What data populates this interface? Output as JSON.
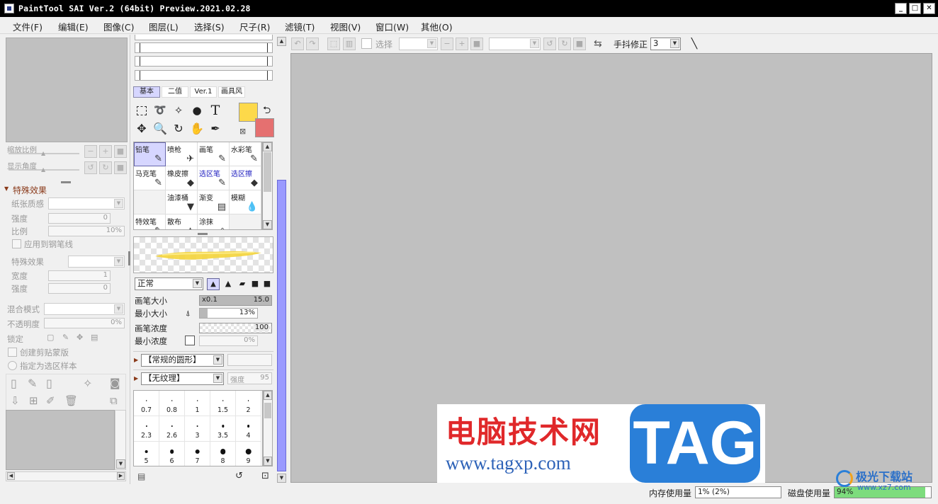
{
  "app": {
    "title": "PaintTool SAI Ver.2 (64bit) Preview.2021.02.28",
    "window_controls": {
      "minimize": "_",
      "maximize": "□",
      "close": "✕"
    }
  },
  "menu": [
    "文件(F)",
    "编辑(E)",
    "图像(C)",
    "图层(L)",
    "选择(S)",
    "尺子(R)",
    "滤镜(T)",
    "视图(V)",
    "窗口(W)",
    "其他(O)"
  ],
  "navigator": {
    "zoom_label": "缩放比例",
    "angle_label": "显示角度"
  },
  "effects": {
    "header": "特殊效果",
    "paper_texture": "纸张质感",
    "strength": "强度",
    "strength_value": "0",
    "scale": "比例",
    "scale_value": "10%",
    "apply_pen": "应用到钢笔线",
    "special_effect": "特殊效果",
    "width": "宽度",
    "width_value": "1",
    "strength2": "强度",
    "strength2_value": "0"
  },
  "layer": {
    "blend_mode": "混合模式",
    "opacity": "不透明度",
    "opacity_value": "0%",
    "lock": "锁定",
    "clipping": "创建剪贴蒙版",
    "selection_source": "指定为选区样本"
  },
  "tool_tabs": [
    "基本",
    "二值",
    "Ver.1",
    "画具风"
  ],
  "colors": {
    "primary": "#fdd94a",
    "secondary": "#e57070",
    "accent": "#9a9aff"
  },
  "brushes": [
    {
      "label": "铅笔",
      "icon": "✎",
      "selected": true
    },
    {
      "label": "喷枪",
      "icon": "✈",
      "selected": false
    },
    {
      "label": "画笔",
      "icon": "✎",
      "selected": false
    },
    {
      "label": "水彩笔",
      "icon": "✎",
      "selected": false
    },
    {
      "label": "马克笔",
      "icon": "✎",
      "selected": false
    },
    {
      "label": "橡皮擦",
      "icon": "◆",
      "selected": false
    },
    {
      "label": "选区笔",
      "icon": "✎",
      "selected": false
    },
    {
      "label": "选区擦",
      "icon": "◆",
      "selected": false
    },
    {
      "label": "",
      "icon": "",
      "selected": false
    },
    {
      "label": "油漆桶",
      "icon": "▼",
      "selected": false
    },
    {
      "label": "渐变",
      "icon": "▤",
      "selected": false
    },
    {
      "label": "模糊",
      "icon": "💧",
      "selected": false
    },
    {
      "label": "特效笔",
      "icon": "✎",
      "selected": false
    },
    {
      "label": "散布",
      "icon": "✦",
      "selected": false
    },
    {
      "label": "涂抹",
      "icon": "◇",
      "selected": false
    },
    {
      "label": "",
      "icon": "",
      "selected": false
    }
  ],
  "brush_settings": {
    "mode": "正常",
    "size_label": "画笔大小",
    "size_mult": "x0.1",
    "size_value": "15.0",
    "min_size_label": "最小大小",
    "min_size_value": "13%",
    "min_size_fill": 0.13,
    "density_label": "画笔浓度",
    "density_value": "100",
    "min_density_label": "最小浓度",
    "min_density_value": "0%",
    "shape": "【常规的圆形】",
    "texture": "【无纹理】",
    "texture_strength_label": "强度",
    "texture_strength_value": "95"
  },
  "brush_sizes": [
    [
      "0.7",
      "0.8",
      "1",
      "1.5",
      "2"
    ],
    [
      "2.3",
      "2.6",
      "3",
      "3.5",
      "4"
    ],
    [
      "5",
      "6",
      "7",
      "8",
      "9"
    ]
  ],
  "toolbar": {
    "select_label": "选择",
    "stabilizer_label": "手抖修正",
    "stabilizer_value": "3"
  },
  "status": {
    "memory_label": "内存使用量",
    "memory_value": "1% (2%)",
    "disk_label": "磁盘使用量",
    "disk_value": "94%"
  },
  "watermark": {
    "site_cn": "电脑技术网",
    "site_url": "www.tagxp.com",
    "tag": "TAG",
    "corner": "极光下载站",
    "corner_url": "www.xz7.com"
  }
}
